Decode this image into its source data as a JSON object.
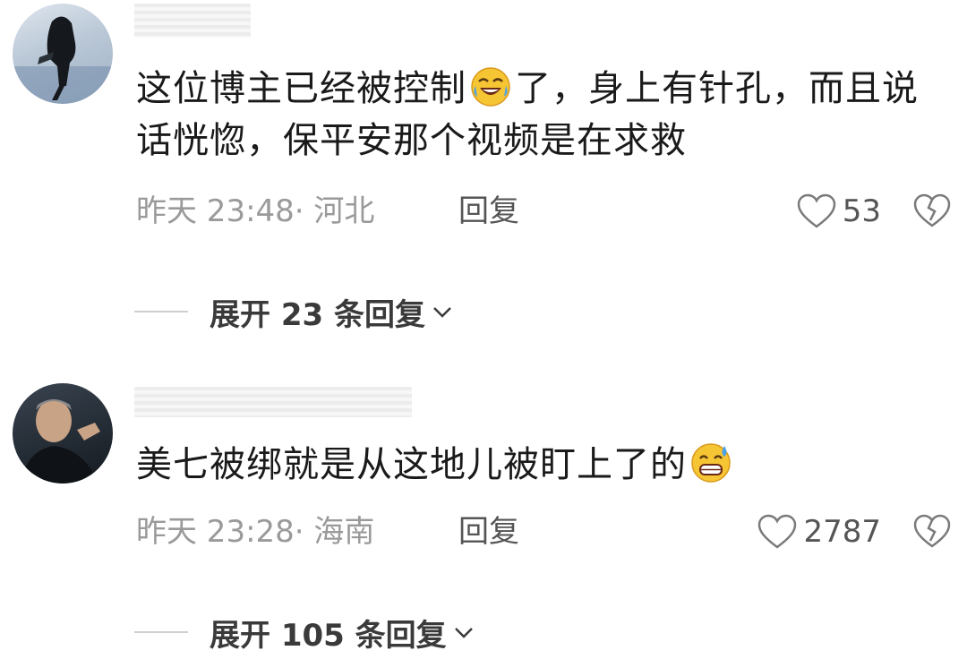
{
  "comments": [
    {
      "text_a": "这位博主已经被控制",
      "emoji_a": "rofl-emoji",
      "text_b": "了，身上有针孔，而且说话恍惚，保平安那个视频是在求救",
      "time": "昨天 23:48· 河北",
      "reply_label": "回复",
      "likes": "53",
      "expand_label": "展开 23 条回复"
    },
    {
      "text_a": "美七被绑就是从这地儿被盯上了的",
      "emoji_a": "grin-sweat-emoji",
      "text_b": "",
      "time": "昨天 23:28· 海南",
      "reply_label": "回复",
      "likes": "2787",
      "expand_label": "展开 105 条回复"
    }
  ],
  "icons": {
    "like": "heart-outline-icon",
    "dislike": "broken-heart-icon",
    "expand": "chevron-down-icon"
  },
  "colors": {
    "meta_text": "#9a9a9a",
    "emoji_yellow": "#f6c533"
  }
}
